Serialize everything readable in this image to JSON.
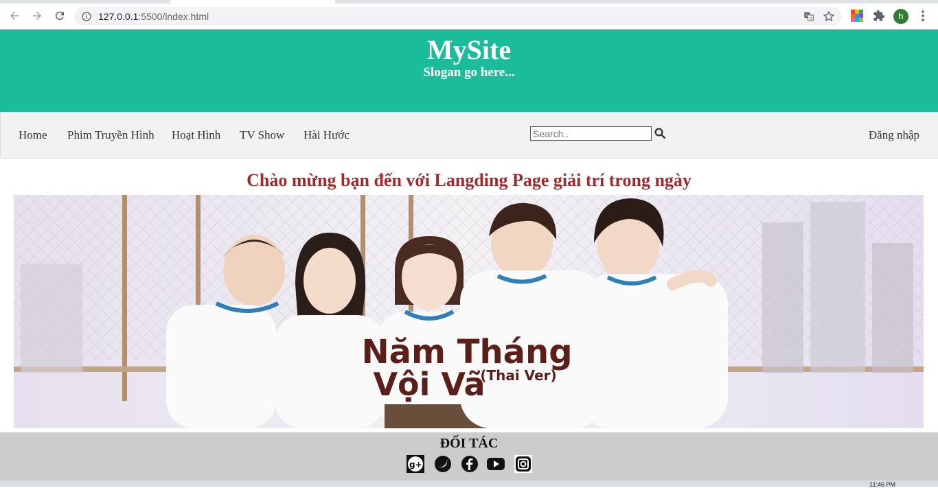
{
  "browser": {
    "url_host": "127.0.0.1",
    "url_rest": ":5500/index.html",
    "avatar_letter": "h"
  },
  "header": {
    "title": "MySite",
    "slogan": "Slogan go here..."
  },
  "nav": {
    "items": [
      "Home",
      "Phim Truyền Hình",
      "Hoạt Hình",
      "TV Show",
      "Hài Hước"
    ],
    "search_placeholder": "Search..",
    "login": "Đăng nhập"
  },
  "main": {
    "welcome": "Chào mừng bạn đến với Langding Page giải trí trong ngày",
    "banner_title_line1": "Năm Tháng",
    "banner_title_line2": "Vội Vã",
    "banner_subtitle": "(Thai Ver)"
  },
  "footer": {
    "title": "ĐỐI TÁC",
    "socials": [
      "google-plus-icon",
      "twitter-icon",
      "facebook-icon",
      "youtube-icon",
      "instagram-icon"
    ]
  },
  "taskbar": {
    "clock": "11:46 PM"
  },
  "colors": {
    "header_bg": "#1abc9c",
    "welcome_text": "#9e2a2b",
    "footer_bg": "#cccccc"
  }
}
